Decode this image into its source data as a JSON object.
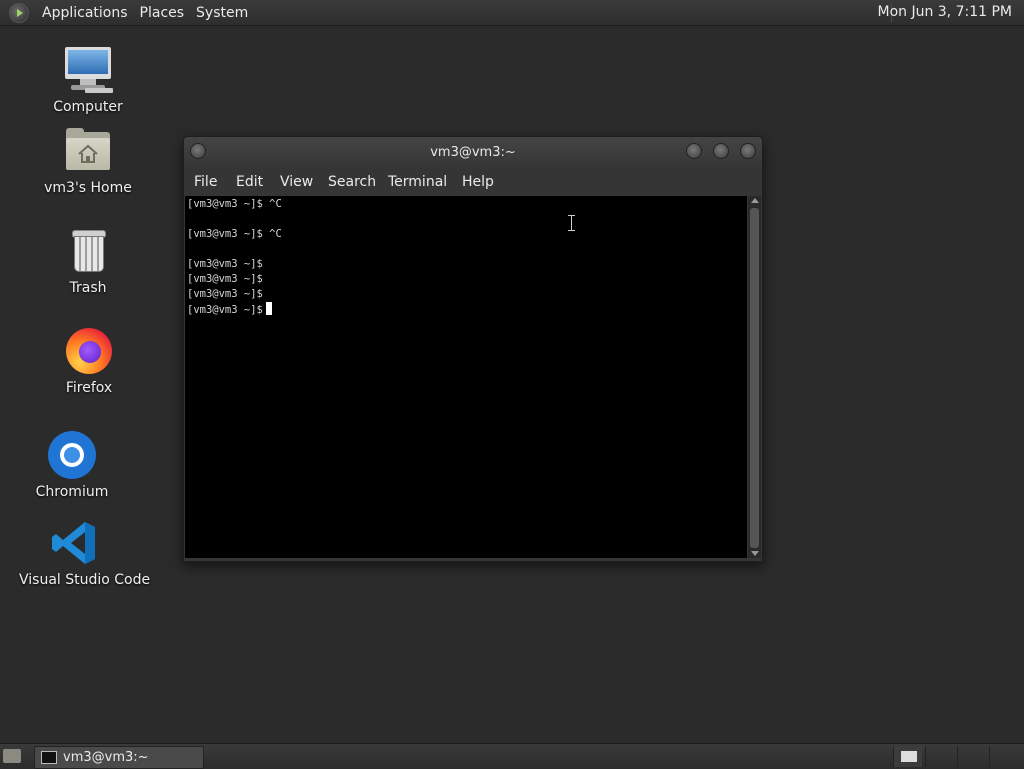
{
  "top_panel": {
    "menus": [
      "Applications",
      "Places",
      "System"
    ],
    "clock": "Mon Jun  3,  7:11 PM",
    "icons": {
      "apps": "mate-logo-icon"
    }
  },
  "desktop": {
    "icons": [
      {
        "label": "Computer",
        "icon": "computer-icon"
      },
      {
        "label": "vm3's Home",
        "icon": "home-folder-icon"
      },
      {
        "label": "Trash",
        "icon": "trash-icon"
      },
      {
        "label": "Firefox",
        "icon": "firefox-icon"
      },
      {
        "label": "Chromium",
        "icon": "chromium-icon"
      },
      {
        "label": "Visual Studio Code",
        "icon": "vscode-icon"
      }
    ]
  },
  "terminal_window": {
    "title": "vm3@vm3:~",
    "menu": [
      "File",
      "Edit",
      "View",
      "Search",
      "Terminal",
      "Help"
    ],
    "lines": [
      "[vm3@vm3 ~]$ ^C",
      "",
      "[vm3@vm3 ~]$ ^C",
      "",
      "[vm3@vm3 ~]$",
      "[vm3@vm3 ~]$",
      "[vm3@vm3 ~]$",
      "[vm3@vm3 ~]$"
    ]
  },
  "bottom_panel": {
    "tasks": [
      {
        "label": "vm3@vm3:~",
        "icon": "terminal-icon"
      }
    ],
    "workspaces": 4
  },
  "colors": {
    "desktop_bg": "#2b2b2b",
    "panel_bg": "#333333",
    "terminal_bg": "#000000",
    "terminal_fg": "#d8d8d8"
  }
}
